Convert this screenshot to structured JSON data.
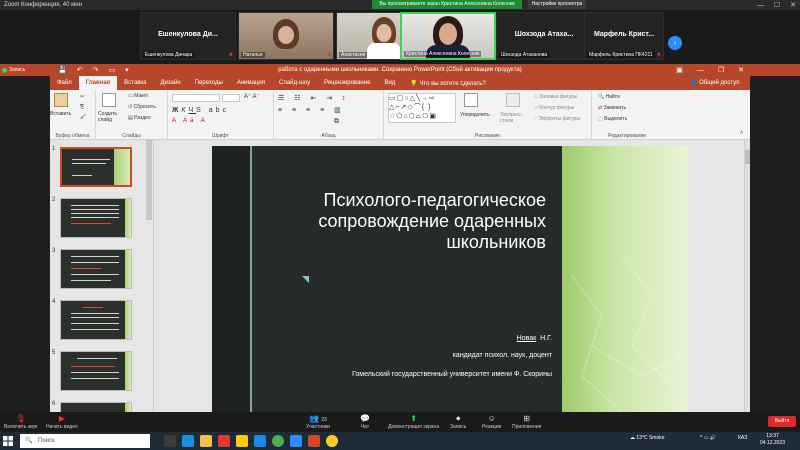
{
  "zoom": {
    "window_title": "Zoom Конференция, 40 мин",
    "share_banner": "Вы просматриваете экран Кристина Алексеевна Колесник",
    "view_options": "Настройки просмотра"
  },
  "participants": [
    {
      "name": "Ешенкулова Ди...",
      "label": "Ешенкулова Динара",
      "video": false
    },
    {
      "name": "",
      "label": "Наталья",
      "video": true
    },
    {
      "name": "",
      "label": "Анастасия",
      "video": true
    },
    {
      "name": "",
      "label": "Кристина Алексеевна Колесник",
      "video": true,
      "active": true
    },
    {
      "name": "Шохзода Атаха...",
      "label": "Шохзода Атаханова",
      "video": false
    },
    {
      "name": "Марфель Крист...",
      "label": "Марфель Кристина ПК4211",
      "video": false
    }
  ],
  "recording": {
    "label": "Запись"
  },
  "powerpoint": {
    "doc_title": "работа с одаренными школьниками. Сохранено   PowerPoint (Сбой активации продукта)",
    "tabs": [
      "Файл",
      "Главная",
      "Вставка",
      "Дизайн",
      "Переходы",
      "Анимация",
      "Слайд-шоу",
      "Рецензирование",
      "Вид"
    ],
    "active_tab": "Главная",
    "tell_me": "Что вы хотите сделать?",
    "share": "Общий доступ",
    "ribbon": {
      "paste": "Вставить",
      "clipboard_group": "Буфер обмена",
      "layout": "Макет",
      "reset": "Сбросить",
      "new_slide": "Создать слайд",
      "section": "Раздел",
      "slides_group": "Слайды",
      "font_group": "Шрифт",
      "paragraph_group": "Абзац",
      "arrange": "Упорядочить",
      "quick_styles": "Экспресс-стили",
      "shape_fill": "Заливка фигуры",
      "shape_outline": "Контур фигуры",
      "shape_effects": "Эффекты фигуры",
      "drawing_group": "Рисование",
      "find": "Найти",
      "replace": "Заменить",
      "select": "Выделить",
      "editing_group": "Редактирование"
    },
    "thumbnails": [
      "1",
      "2",
      "3",
      "4",
      "5",
      "6"
    ],
    "slide": {
      "title_line1": "Психолого-педагогическое",
      "title_line2": "сопровождение одаренных",
      "title_line3": "школьников",
      "author_surname": "Новак",
      "author_initials": "Н.Г.",
      "degree": "кандидат психол. наук, доцент",
      "university": "Гомельский государственный университет имени Ф. Скорины"
    }
  },
  "toolbar": {
    "mute": "Включить звук",
    "video": "Начать видео",
    "participants": "Участники",
    "participants_count": "23",
    "chat": "Чат",
    "share": "Демонстрация экрана",
    "record": "Запись",
    "reactions": "Реакции",
    "apps": "Приложения",
    "leave": "Выйти"
  },
  "taskbar": {
    "search": "Поиск",
    "weather": "13°C  Smoke",
    "lang": "КАЗ",
    "time": "13:37",
    "date": "04.12.2023"
  },
  "colors": {
    "ppt_accent": "#b7472a",
    "zoom_green": "#1d8a34",
    "slide_green": "#9fca6c"
  }
}
